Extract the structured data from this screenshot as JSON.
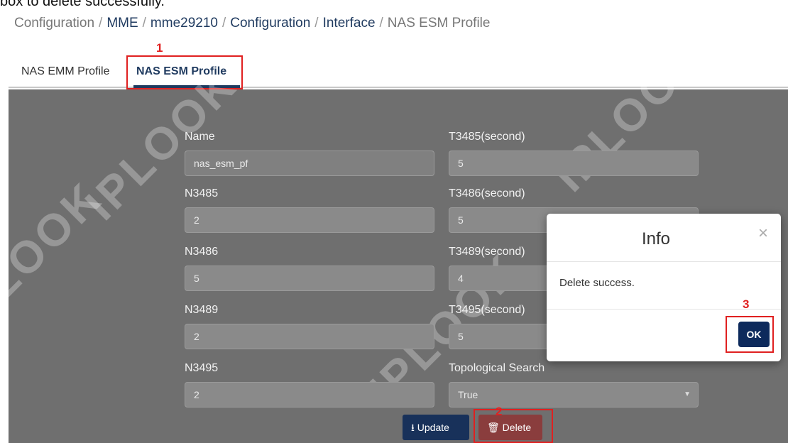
{
  "caption_fragment": "box to delete successfully.",
  "breadcrumb": {
    "items": [
      "Configuration",
      "MME",
      "mme29210",
      "Configuration",
      "Interface",
      "NAS ESM Profile"
    ],
    "separator": "/"
  },
  "tabs": [
    {
      "label": "NAS EMM Profile",
      "active": false
    },
    {
      "label": "NAS ESM Profile",
      "active": true
    }
  ],
  "form": {
    "left": [
      {
        "label": "Name",
        "value": "nas_esm_pf",
        "readonly": true
      },
      {
        "label": "N3485",
        "value": "2"
      },
      {
        "label": "N3486",
        "value": "5"
      },
      {
        "label": "N3489",
        "value": "2"
      },
      {
        "label": "N3495",
        "value": "2"
      }
    ],
    "right": [
      {
        "label": "T3485(second)",
        "value": "5"
      },
      {
        "label": "T3486(second)",
        "value": "5"
      },
      {
        "label": "T3489(second)",
        "value": "4"
      },
      {
        "label": "T3495(second)",
        "value": "5"
      },
      {
        "label": "Topological Search",
        "value": "True"
      }
    ]
  },
  "buttons": {
    "update_label": "Update",
    "delete_label": "Delete"
  },
  "modal": {
    "title": "Info",
    "close_glyph": "×",
    "message": "Delete success.",
    "ok_label": "OK"
  },
  "annotations": {
    "step1": "1",
    "step2": "2",
    "step3": "3"
  },
  "colors": {
    "annotation_red": "#e02020",
    "primary_navy": "#18315a",
    "delete_red": "#8a3d3d",
    "overlay_gray": "#6f6f6f"
  },
  "watermark_text": "IPLOOK"
}
